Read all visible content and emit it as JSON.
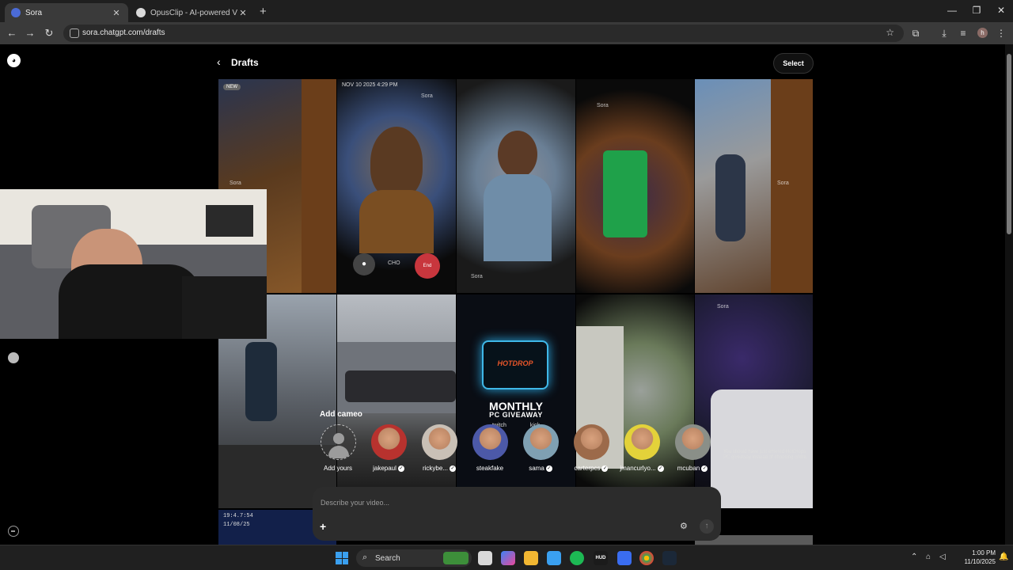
{
  "browser": {
    "tabs": [
      {
        "title": "Sora",
        "active": true
      },
      {
        "title": "OpusClip - AI-powered Video R",
        "active": false
      }
    ],
    "url": "sora.chatgpt.com/drafts",
    "profile_initial": "h"
  },
  "page": {
    "title": "Drafts",
    "select_label": "Select",
    "tiles": {
      "new_badge": "NEW",
      "call_timestamp": "NOV 10 2025  4:29 PM",
      "call_mic_label": "CHO",
      "call_end_label": "End",
      "watermark": "Sora",
      "promo_brand": "HOTDROP",
      "promo_title": "MONTHLY",
      "promo_sub": "PC GIVEAWAY",
      "promo_platforms": [
        "twitch",
        "kick"
      ],
      "police_caption": "You should have just entered HotDrops PC giveaway instead of choosing crime.",
      "dashcam_time": "19:4.7:54",
      "dashcam_date": "11/08/25"
    },
    "cameo": {
      "heading": "Add cameo",
      "items": [
        {
          "name": "Add yours",
          "verified": false,
          "kind": "add"
        },
        {
          "name": "jakepaul",
          "verified": true,
          "color": "#b8322e"
        },
        {
          "name": "rickybe...",
          "verified": true,
          "color": "#c9c0b6"
        },
        {
          "name": "steakfake",
          "verified": false,
          "color": "#4c59a8"
        },
        {
          "name": "sama",
          "verified": true,
          "color": "#7fa0b3"
        },
        {
          "name": "carterpcs",
          "verified": true,
          "color": "#9c6a4a"
        },
        {
          "name": "jmancurlyo...",
          "verified": true,
          "color": "#e3d23a"
        },
        {
          "name": "mcuban",
          "verified": true,
          "color": "#8a8f88"
        }
      ]
    },
    "composer": {
      "placeholder": "Describe your video..."
    }
  },
  "taskbar": {
    "search_label": "Search",
    "time": "1:00 PM",
    "date": "11/10/2025"
  }
}
